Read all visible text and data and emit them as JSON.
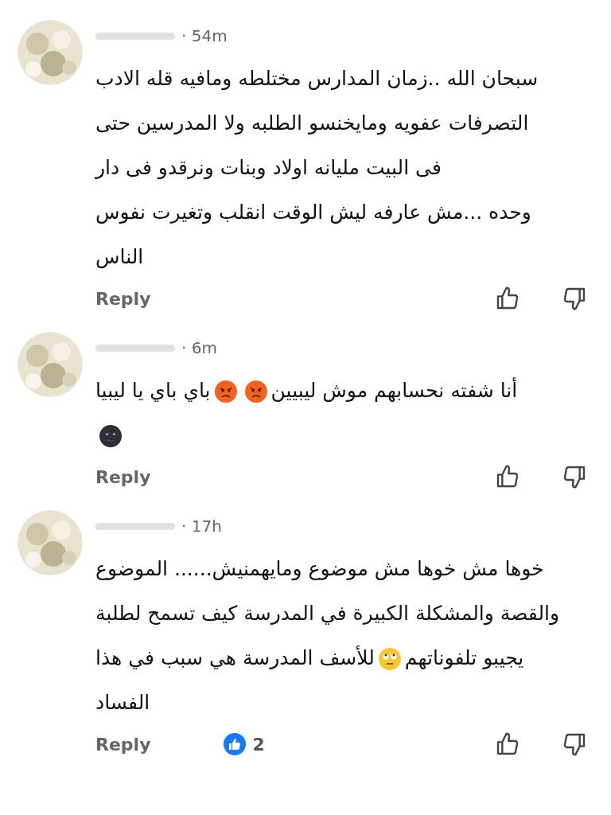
{
  "comments": [
    {
      "time": "· 54m",
      "lines": [
        [
          {
            "kind": "text",
            "text": "سبحان الله ..زمان المدارس مختلطه ومافيه قله الادب"
          }
        ],
        [
          {
            "kind": "text",
            "text": "التصرفات عفويه ومايخنسو الطلبه ولا المدرسين  حتى"
          }
        ],
        [
          {
            "kind": "text",
            "text": "فى البيت مليانه اولاد وبنات ونرقدو فى دار"
          }
        ],
        [
          {
            "kind": "text",
            "text": "وحده ...مش عارفه ليش الوقت انقلب وتغيرت نفوس"
          }
        ],
        [
          {
            "kind": "text",
            "text": "الناس"
          }
        ]
      ],
      "reply": "Reply"
    },
    {
      "time": "· 6m",
      "lines": [
        [
          {
            "kind": "text",
            "text": "أنا شفته نحسابهم موش ليبيين"
          },
          {
            "kind": "angry"
          },
          {
            "kind": "angry"
          },
          {
            "kind": "text",
            "text": "باي باي يا ليبيا"
          }
        ],
        [
          {
            "kind": "moon"
          }
        ]
      ],
      "reply": "Reply"
    },
    {
      "time": "· 17h",
      "lines": [
        [
          {
            "kind": "text",
            "text": "خوها مش خوها مش موضوع ومايهمنيش...... الموضوع"
          }
        ],
        [
          {
            "kind": "text",
            "text": "والقصة والمشكلة الكبيرة في المدرسة كيف تسمح لطلبة"
          }
        ],
        [
          {
            "kind": "text",
            "text": "يجيبو تلفوناتهم"
          },
          {
            "kind": "eyeroll"
          },
          {
            "kind": "text",
            "text": "للأسف المدرسة هي سبب في هذا"
          }
        ],
        [
          {
            "kind": "text",
            "text": "الفساد"
          }
        ]
      ],
      "reply": "Reply",
      "likes": "2"
    }
  ]
}
